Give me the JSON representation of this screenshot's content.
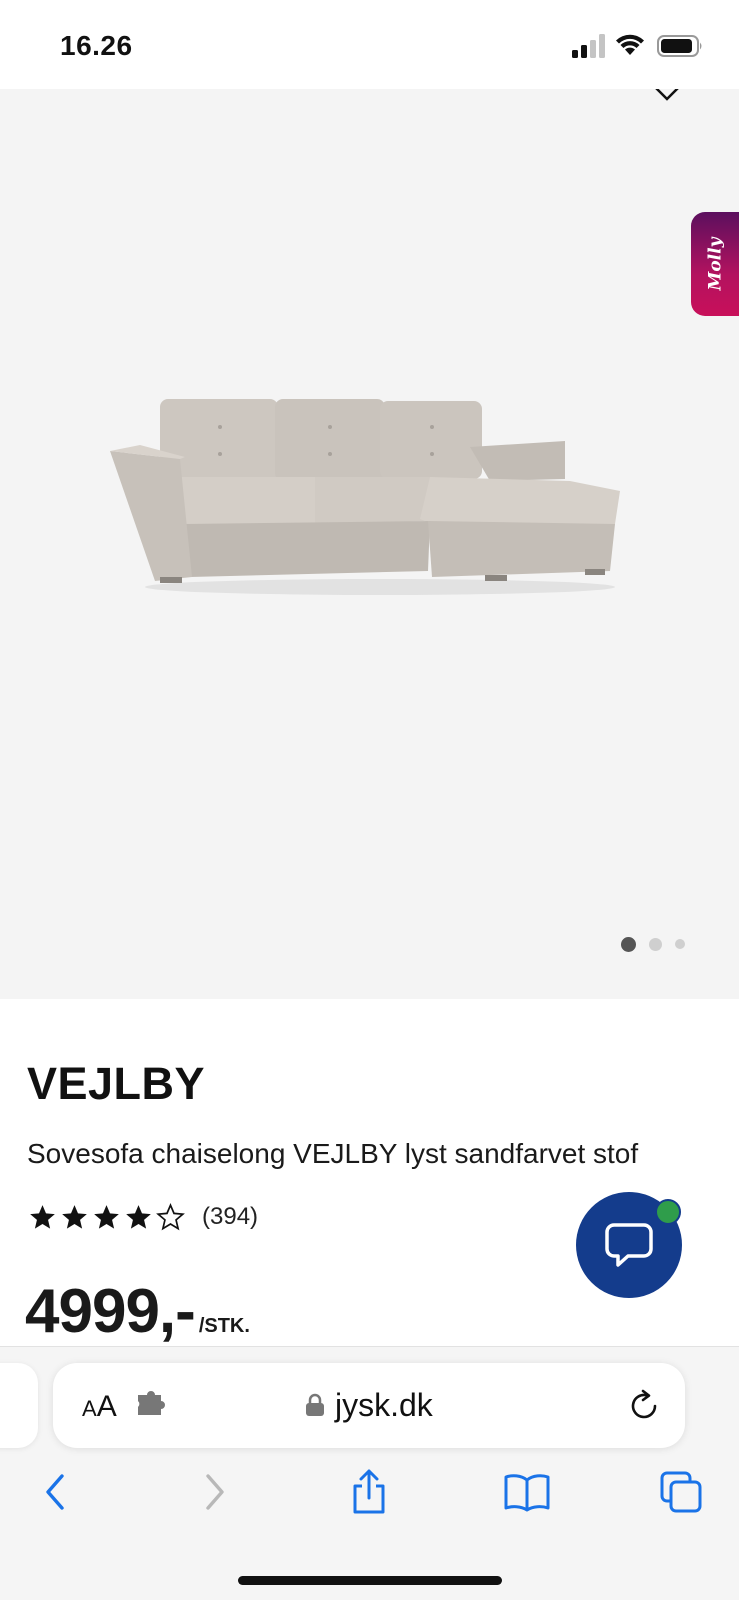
{
  "status_bar": {
    "time": "16.26",
    "signal_icon": "cellular-signal-icon",
    "wifi_icon": "wifi-icon",
    "battery_icon": "battery-icon"
  },
  "gallery": {
    "collapse_icon": "chevron-down-icon",
    "molly_label": "Molly",
    "image_alt": "Sovesofa chaiselong VEJLBY",
    "current_slide": 1,
    "slide_count": 3
  },
  "product": {
    "brand": "VEJLBY",
    "name": "Sovesofa chaiselong VEJLBY lyst sandfarvet stof",
    "rating": 4,
    "rating_max": 5,
    "review_count": "(394)",
    "price": "4999,-",
    "price_unit": "/STK."
  },
  "chat": {
    "icon": "chat-bubble-icon",
    "status": "online",
    "status_color": "#2f9d4b"
  },
  "browser": {
    "aa_small": "A",
    "aa_large": "A",
    "extension_icon": "puzzle-piece-icon",
    "lock_icon": "lock-icon",
    "url": "jysk.dk",
    "reload_icon": "reload-icon",
    "toolbar": {
      "back_icon": "chevron-left-icon",
      "forward_icon": "chevron-right-icon",
      "share_icon": "share-icon",
      "bookmarks_icon": "book-icon",
      "tabs_icon": "tabs-icon"
    }
  },
  "colors": {
    "accent_blue": "#1a73e8",
    "chat_blue": "#143c8c",
    "molly_gradient_start": "#5b0f5e",
    "molly_gradient_end": "#c8105a"
  }
}
